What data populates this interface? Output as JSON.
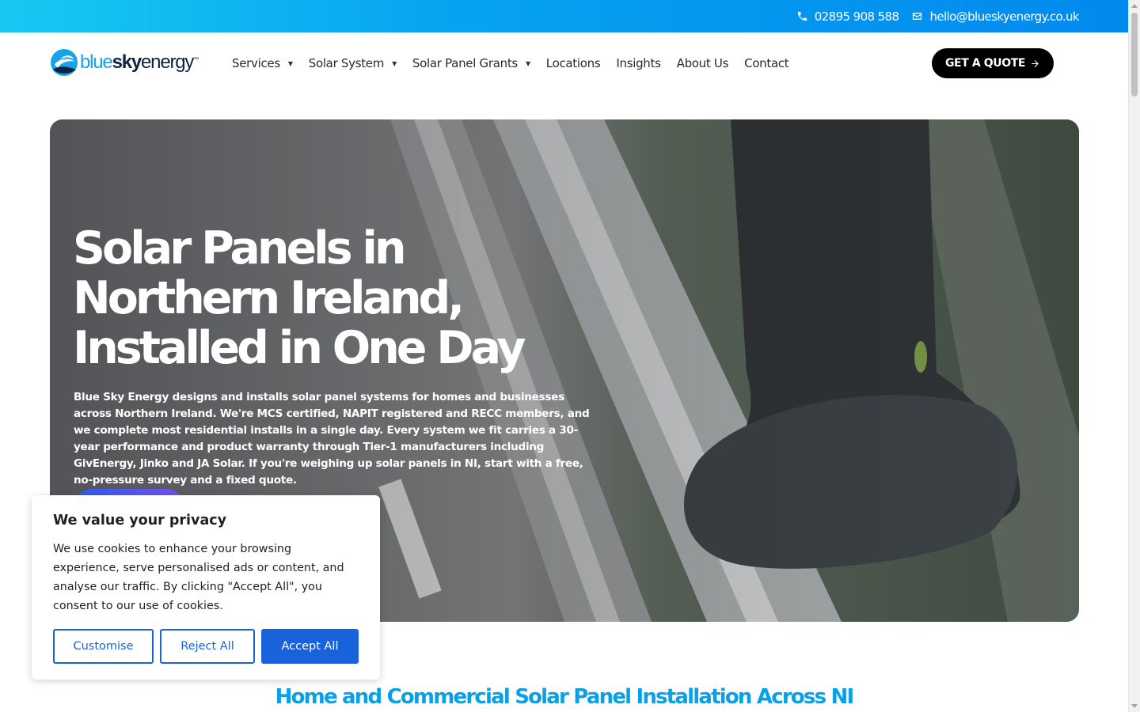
{
  "topbar": {
    "phone": "02895 908 588",
    "email": "hello@blueskyenergy.co.uk",
    "phone_icon": "phone-icon",
    "email_icon": "envelope-icon"
  },
  "logo": {
    "part1": "blue",
    "part2": "sky",
    "part3": "energy",
    "tm": "™"
  },
  "nav": {
    "items": [
      {
        "label": "Services",
        "dropdown": true
      },
      {
        "label": "Solar System",
        "dropdown": true
      },
      {
        "label": "Solar Panel Grants",
        "dropdown": true
      },
      {
        "label": "Locations",
        "dropdown": false
      },
      {
        "label": "Insights",
        "dropdown": false
      },
      {
        "label": "About Us",
        "dropdown": false
      },
      {
        "label": "Contact",
        "dropdown": false
      }
    ],
    "cta": "GET A QUOTE"
  },
  "hero": {
    "title": "Solar Panels in Northern Ireland, Installed in One Day",
    "body": "Blue Sky Energy designs and installs solar panel systems for homes and businesses across Northern Ireland. We're MCS certified, NAPIT registered and RECC members, and we complete most residential installs in a single day. Every system we fit carries a 30-year performance and product warranty through Tier-1 manufacturers including GivEnergy, Jinko and JA Solar. If you're weighing up solar panels in NI, start with a free, no-pressure survey and a fixed quote."
  },
  "section": {
    "heading": "Home and Commercial Solar Panel Installation Across NI"
  },
  "cookie": {
    "title": "We value your privacy",
    "text": "We use cookies to enhance your browsing experience, serve personalised ads or content, and analyse our traffic. By clicking \"Accept All\", you consent to our use of cookies.",
    "customise": "Customise",
    "reject": "Reject All",
    "accept": "Accept All"
  },
  "colors": {
    "brand_blue": "#0aa0e8",
    "cookie_button": "#1863dc"
  }
}
